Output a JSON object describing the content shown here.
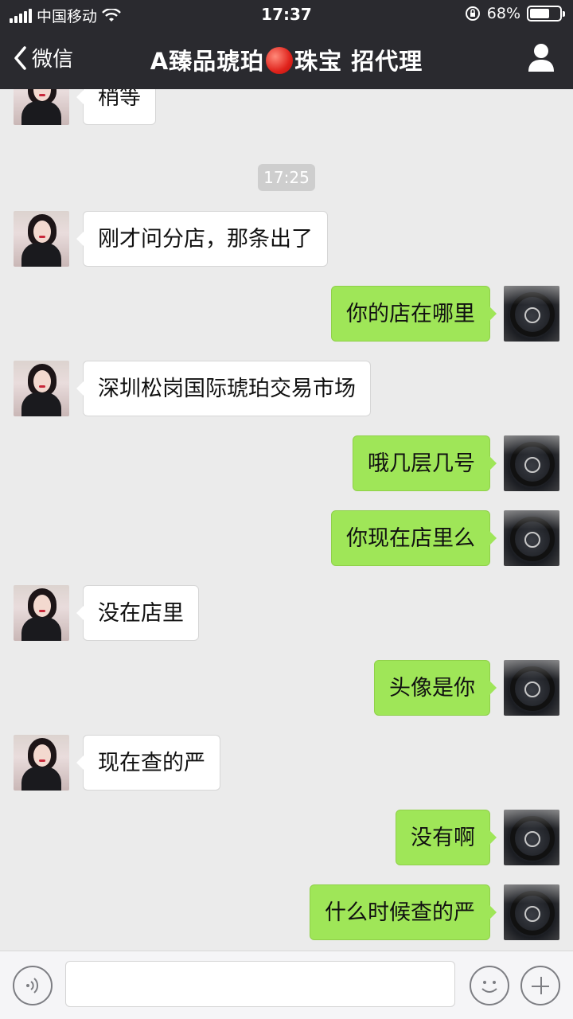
{
  "status_bar": {
    "carrier": "中国移动",
    "time": "17:37",
    "battery_percent": "68%",
    "battery_level": 0.68
  },
  "nav": {
    "back_label": "微信",
    "title_part1": "A臻品琥珀",
    "title_part2": "珠宝 招代理",
    "back_icon": "chevron-left-icon",
    "profile_icon": "person-icon"
  },
  "chat": {
    "timestamp": "17:25",
    "messages": [
      {
        "from": "them",
        "text": "稍等"
      },
      {
        "from": "them",
        "text": "刚才问分店，那条出了"
      },
      {
        "from": "me",
        "text": "你的店在哪里"
      },
      {
        "from": "them",
        "text": "深圳松岗国际琥珀交易市场"
      },
      {
        "from": "me",
        "text": "哦几层几号"
      },
      {
        "from": "me",
        "text": "你现在店里么"
      },
      {
        "from": "them",
        "text": "没在店里"
      },
      {
        "from": "me",
        "text": "头像是你"
      },
      {
        "from": "them",
        "text": "现在查的严"
      },
      {
        "from": "me",
        "text": "没有啊"
      },
      {
        "from": "me",
        "text": "什么时候查的严"
      }
    ]
  },
  "input_bar": {
    "value": "",
    "voice_icon": "voice-icon",
    "emoji_icon": "emoji-icon",
    "plus_icon": "plus-icon"
  },
  "colors": {
    "nav_bg": "#2a2a2f",
    "chat_bg": "#ebebeb",
    "outgoing_bubble": "#9fe658",
    "incoming_bubble": "#ffffff"
  }
}
